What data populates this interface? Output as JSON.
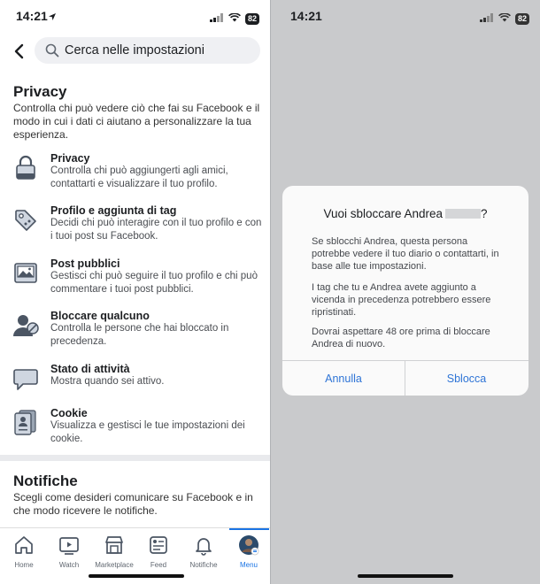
{
  "left": {
    "status": {
      "time": "14:21",
      "battery": "82"
    },
    "search": {
      "placeholder": "Cerca nelle impostazioni"
    },
    "privacy_section": {
      "title": "Privacy",
      "description": "Controlla chi può vedere ciò che fai su Facebook e il modo in cui i dati ci aiutano a personalizzare la tua esperienza.",
      "items": [
        {
          "icon": "lock-icon",
          "title": "Privacy",
          "desc": "Controlla chi può aggiungerti agli amici, contattarti e visualizzare il tuo profilo."
        },
        {
          "icon": "tag-icon",
          "title": "Profilo e aggiunta di tag",
          "desc": "Decidi chi può interagire con il tuo profilo e con i tuoi post su Facebook."
        },
        {
          "icon": "image-post-icon",
          "title": "Post pubblici",
          "desc": "Gestisci chi può seguire il tuo profilo e chi può commentare i tuoi post pubblici."
        },
        {
          "icon": "block-user-icon",
          "title": "Bloccare qualcuno",
          "desc": "Controlla le persone che hai bloccato in precedenza."
        },
        {
          "icon": "speech-bubble-icon",
          "title": "Stato di attività",
          "desc": "Mostra quando sei attivo."
        },
        {
          "icon": "cookie-doc-icon",
          "title": "Cookie",
          "desc": "Visualizza e gestisci le tue impostazioni dei cookie."
        }
      ]
    },
    "notifications_section": {
      "title": "Notifiche",
      "description": "Scegli come desideri comunicare su Facebook e in che modo ricevere le notifiche."
    },
    "tabbar": {
      "tabs": [
        {
          "label": "Home",
          "icon": "home-icon"
        },
        {
          "label": "Watch",
          "icon": "watch-icon"
        },
        {
          "label": "Marketplace",
          "icon": "marketplace-icon"
        },
        {
          "label": "Feed",
          "icon": "feed-icon"
        },
        {
          "label": "Notifiche",
          "icon": "bell-icon"
        },
        {
          "label": "Menu",
          "icon": "avatar-icon"
        }
      ],
      "active": "Menu",
      "accent": "#1b74e4"
    }
  },
  "right": {
    "status": {
      "time": "14:21",
      "battery": "82"
    },
    "dialog": {
      "title": "Vuoi sbloccare Andrea",
      "title_suffix": "?",
      "paragraphs": [
        "Se sblocchi Andrea, questa persona potrebbe vedere il tuo diario o contattarti, in base alle tue impostazioni.",
        "I tag che tu e Andrea avete aggiunto a vicenda in precedenza potrebbero essere ripristinati.",
        "Dovrai aspettare 48 ore prima di bloccare Andrea di nuovo."
      ],
      "cancel_label": "Annulla",
      "confirm_label": "Sblocca",
      "button_color": "#2e74d6"
    }
  }
}
